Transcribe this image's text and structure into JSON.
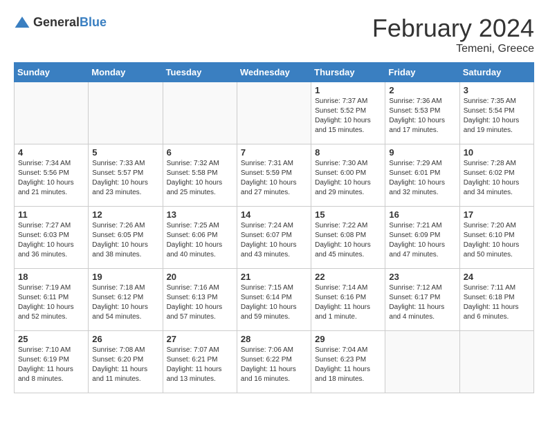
{
  "header": {
    "logo_general": "General",
    "logo_blue": "Blue",
    "month_year": "February 2024",
    "location": "Temeni, Greece"
  },
  "weekdays": [
    "Sunday",
    "Monday",
    "Tuesday",
    "Wednesday",
    "Thursday",
    "Friday",
    "Saturday"
  ],
  "weeks": [
    [
      {
        "day": "",
        "info": ""
      },
      {
        "day": "",
        "info": ""
      },
      {
        "day": "",
        "info": ""
      },
      {
        "day": "",
        "info": ""
      },
      {
        "day": "1",
        "info": "Sunrise: 7:37 AM\nSunset: 5:52 PM\nDaylight: 10 hours\nand 15 minutes."
      },
      {
        "day": "2",
        "info": "Sunrise: 7:36 AM\nSunset: 5:53 PM\nDaylight: 10 hours\nand 17 minutes."
      },
      {
        "day": "3",
        "info": "Sunrise: 7:35 AM\nSunset: 5:54 PM\nDaylight: 10 hours\nand 19 minutes."
      }
    ],
    [
      {
        "day": "4",
        "info": "Sunrise: 7:34 AM\nSunset: 5:56 PM\nDaylight: 10 hours\nand 21 minutes."
      },
      {
        "day": "5",
        "info": "Sunrise: 7:33 AM\nSunset: 5:57 PM\nDaylight: 10 hours\nand 23 minutes."
      },
      {
        "day": "6",
        "info": "Sunrise: 7:32 AM\nSunset: 5:58 PM\nDaylight: 10 hours\nand 25 minutes."
      },
      {
        "day": "7",
        "info": "Sunrise: 7:31 AM\nSunset: 5:59 PM\nDaylight: 10 hours\nand 27 minutes."
      },
      {
        "day": "8",
        "info": "Sunrise: 7:30 AM\nSunset: 6:00 PM\nDaylight: 10 hours\nand 29 minutes."
      },
      {
        "day": "9",
        "info": "Sunrise: 7:29 AM\nSunset: 6:01 PM\nDaylight: 10 hours\nand 32 minutes."
      },
      {
        "day": "10",
        "info": "Sunrise: 7:28 AM\nSunset: 6:02 PM\nDaylight: 10 hours\nand 34 minutes."
      }
    ],
    [
      {
        "day": "11",
        "info": "Sunrise: 7:27 AM\nSunset: 6:03 PM\nDaylight: 10 hours\nand 36 minutes."
      },
      {
        "day": "12",
        "info": "Sunrise: 7:26 AM\nSunset: 6:05 PM\nDaylight: 10 hours\nand 38 minutes."
      },
      {
        "day": "13",
        "info": "Sunrise: 7:25 AM\nSunset: 6:06 PM\nDaylight: 10 hours\nand 40 minutes."
      },
      {
        "day": "14",
        "info": "Sunrise: 7:24 AM\nSunset: 6:07 PM\nDaylight: 10 hours\nand 43 minutes."
      },
      {
        "day": "15",
        "info": "Sunrise: 7:22 AM\nSunset: 6:08 PM\nDaylight: 10 hours\nand 45 minutes."
      },
      {
        "day": "16",
        "info": "Sunrise: 7:21 AM\nSunset: 6:09 PM\nDaylight: 10 hours\nand 47 minutes."
      },
      {
        "day": "17",
        "info": "Sunrise: 7:20 AM\nSunset: 6:10 PM\nDaylight: 10 hours\nand 50 minutes."
      }
    ],
    [
      {
        "day": "18",
        "info": "Sunrise: 7:19 AM\nSunset: 6:11 PM\nDaylight: 10 hours\nand 52 minutes."
      },
      {
        "day": "19",
        "info": "Sunrise: 7:18 AM\nSunset: 6:12 PM\nDaylight: 10 hours\nand 54 minutes."
      },
      {
        "day": "20",
        "info": "Sunrise: 7:16 AM\nSunset: 6:13 PM\nDaylight: 10 hours\nand 57 minutes."
      },
      {
        "day": "21",
        "info": "Sunrise: 7:15 AM\nSunset: 6:14 PM\nDaylight: 10 hours\nand 59 minutes."
      },
      {
        "day": "22",
        "info": "Sunrise: 7:14 AM\nSunset: 6:16 PM\nDaylight: 11 hours\nand 1 minute."
      },
      {
        "day": "23",
        "info": "Sunrise: 7:12 AM\nSunset: 6:17 PM\nDaylight: 11 hours\nand 4 minutes."
      },
      {
        "day": "24",
        "info": "Sunrise: 7:11 AM\nSunset: 6:18 PM\nDaylight: 11 hours\nand 6 minutes."
      }
    ],
    [
      {
        "day": "25",
        "info": "Sunrise: 7:10 AM\nSunset: 6:19 PM\nDaylight: 11 hours\nand 8 minutes."
      },
      {
        "day": "26",
        "info": "Sunrise: 7:08 AM\nSunset: 6:20 PM\nDaylight: 11 hours\nand 11 minutes."
      },
      {
        "day": "27",
        "info": "Sunrise: 7:07 AM\nSunset: 6:21 PM\nDaylight: 11 hours\nand 13 minutes."
      },
      {
        "day": "28",
        "info": "Sunrise: 7:06 AM\nSunset: 6:22 PM\nDaylight: 11 hours\nand 16 minutes."
      },
      {
        "day": "29",
        "info": "Sunrise: 7:04 AM\nSunset: 6:23 PM\nDaylight: 11 hours\nand 18 minutes."
      },
      {
        "day": "",
        "info": ""
      },
      {
        "day": "",
        "info": ""
      }
    ]
  ]
}
